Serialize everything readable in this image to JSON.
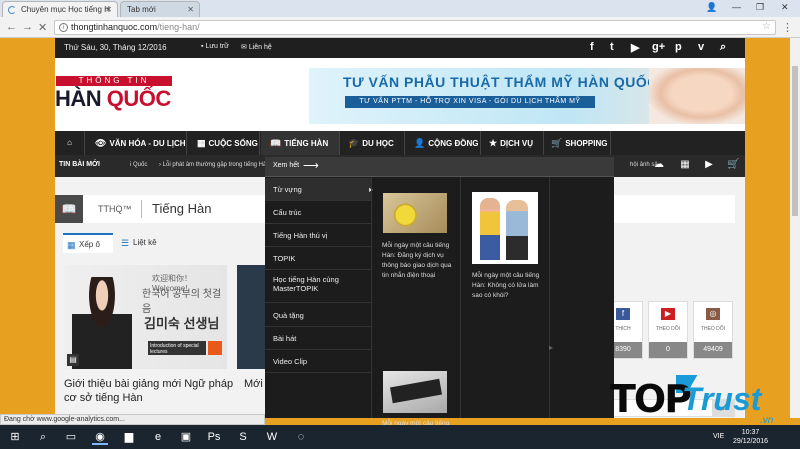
{
  "browser": {
    "tabs": [
      {
        "label": "Chuyên mục Học tiếng H",
        "active": true
      },
      {
        "label": "Tab mới",
        "active": false
      }
    ],
    "url_domain": "thongtinhanquoc.com",
    "url_path": "/tieng-han/",
    "status": "Đang chờ www.google-analytics.com..."
  },
  "topbar": {
    "date": "Thứ Sáu, 30, Tháng 12/2016",
    "links": [
      "Lưu trữ",
      "Liên hệ"
    ],
    "social_icons": [
      "facebook-icon",
      "twitter-icon",
      "youtube-icon",
      "google-plus-icon",
      "pinterest-icon",
      "vimeo-icon",
      "search-icon"
    ]
  },
  "logo": {
    "top": "THÔNG TIN",
    "main_dark": "HÀN ",
    "main_red": "QUỐC"
  },
  "banner": {
    "title": "TƯ VẤN PHẪU THUẬT THẨM MỸ HÀN QUỐC",
    "subtitle": "TƯ VẤN PTTM  -  HỖ TRỢ XIN VISA  -  GÓI DU LỊCH THẨM MỸ"
  },
  "nav": {
    "home_icon": "home-icon",
    "items": [
      {
        "label": "VĂN HÓA - DU LỊCH",
        "icon": "eye-icon"
      },
      {
        "label": "CUỘC SỐNG",
        "icon": "grid-icon"
      },
      {
        "label": "TIẾNG HÀN",
        "icon": "book-icon"
      },
      {
        "label": "DU HỌC",
        "icon": "graduation-cap-icon"
      },
      {
        "label": "CỘNG ĐỒNG",
        "icon": "user-plus-icon"
      },
      {
        "label": "DỊCH VỤ",
        "icon": "star-icon"
      },
      {
        "label": "SHOPPING",
        "icon": "cart-icon"
      }
    ]
  },
  "ticker": {
    "label": "TIN BÀI MỚI",
    "text1": "i Quốc",
    "text2": "Lỗi phát âm thường gặp trong tiếng Hà",
    "text3": "hội ảnh sả"
  },
  "content": {
    "breadcrumb_site": "TTHQ™",
    "page_title": "Tiếng Hàn",
    "view_tabs": [
      "Xếp ô",
      "Liệt kê"
    ],
    "card1_img": {
      "hello": "欢迎和你！Welcome!",
      "korean": "한국어 공부의 첫걸음",
      "name": "김미숙 선생님",
      "intro": "Introduction of special lectures"
    },
    "card1_title": "Giới thiệu bài giảng mới Ngữ pháp cơ sở tiếng Hàn",
    "card2_title": "Mới",
    "social": [
      {
        "label": "THÍCH",
        "icon": "facebook-icon",
        "count": "8390",
        "color": "#3b5998"
      },
      {
        "label": "THEO DÕI",
        "icon": "youtube-icon",
        "count": "0",
        "color": "#cc2020"
      },
      {
        "label": "THEO DÕI",
        "icon": "instagram-icon",
        "count": "49409",
        "color": "#8a5a44"
      }
    ]
  },
  "megamenu": {
    "header": "Xem hết",
    "subitems": [
      "Từ vựng",
      "Cấu trúc",
      "Tiếng Hàn thú vị",
      "TOPIK",
      "Học tiếng Hàn cùng MasterTOPIK",
      "Quà tặng",
      "Bài hát",
      "Video Clip"
    ],
    "posts": [
      {
        "caption": "Mỗi ngày một câu tiếng Hàn: Đăng ký dịch vụ thông báo giao dịch qua tin nhắn điện thoại"
      },
      {
        "caption": "Mỗi ngày một câu tiếng Hàn: Không có lửa làm sao có khói?"
      },
      {
        "caption": "Mỗi ngày một câu tiếng"
      }
    ]
  },
  "taskbar": {
    "lang": "VIE",
    "time": "10:37",
    "date": "29/12/2016"
  },
  "watermark": {
    "top": "TOP",
    "trust": "Trust",
    "vn": ".vn"
  }
}
